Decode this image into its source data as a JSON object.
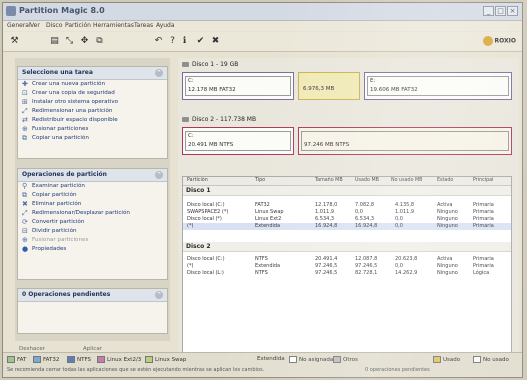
{
  "window": {
    "title": "Partition Magic 8.0"
  },
  "menu": [
    "General",
    "Ver",
    "Disco",
    "Partición",
    "Herramientas",
    "Tareas",
    "Ayuda"
  ],
  "brand": "ROXIO",
  "icons": {
    "undo": "undo-icon",
    "redo": "redo-icon",
    "help": "help-icon"
  },
  "tasks_panel": {
    "title": "Seleccione una tarea",
    "items": [
      "Crear una nueva partición",
      "Crear una copia de seguridad",
      "Instalar otro sistema operativo",
      "Redimensionar una partición",
      "Redistribuir espacio disponible",
      "Fusionar particiones",
      "Copiar una partición"
    ]
  },
  "ops_panel": {
    "title": "Operaciones de partición",
    "items": [
      "Examinar partición",
      "Copiar partición",
      "Eliminar partición",
      "Redimensionar/Desplazar partición",
      "Convertir partición",
      "Dividir partición",
      "Fusionar particiones",
      "Propiedades"
    ]
  },
  "pending_panel": {
    "title": "0 Operaciones pendientes"
  },
  "left_buttons": {
    "undo": "Deshacer",
    "apply": "Aplicar"
  },
  "disk1": {
    "label": "Disco 1 - 19 GB",
    "partitions": [
      {
        "label": "C:",
        "detail": "12.178 MB   FAT32"
      },
      {
        "label": "",
        "detail": "6.976,3 MB"
      },
      {
        "label": "E:",
        "detail": "19.606 MB   FAT32"
      }
    ]
  },
  "disk2": {
    "label": "Disco 2 - 117.738 MB",
    "partitions": [
      {
        "label": "C:",
        "detail": "20.491 MB   NTFS"
      },
      {
        "label": "",
        "detail": "97.246 MB   NTFS"
      }
    ]
  },
  "table": {
    "headers": [
      "Partición",
      "Tipo",
      "Tamaño MB",
      "Usado MB",
      "No usado MB",
      "Estado",
      "Principal"
    ],
    "groups": [
      {
        "title": "Disco 1",
        "rows": [
          [
            "Disco local (C:)",
            "FAT32",
            "12.178,0",
            "7.082,8",
            "4.135,8",
            "Activa",
            "Primaria"
          ],
          [
            "SWAPSPACE2 (*)",
            "Linux Swap",
            "1.011,9",
            "0,0",
            "1.011,9",
            "Ninguno",
            "Primaria"
          ],
          [
            "Disco local (*)",
            "Linux Ext2",
            "6.534,3",
            "6.534,3",
            "0,0",
            "Ninguno",
            "Primaria"
          ],
          [
            "(*)",
            "Extendida",
            "16.924,8",
            "16.924,8",
            "0,0",
            "Ninguno",
            "Primaria"
          ]
        ]
      },
      {
        "title": "Disco 2",
        "rows": [
          [
            "Disco local (C:)",
            "NTFS",
            "20.491,4",
            "12.087,8",
            "20.623,8",
            "Activa",
            "Primaria"
          ],
          [
            "(*)",
            "Extendida",
            "97.246,5",
            "97.246,5",
            "0,0",
            "Ninguno",
            "Primaria"
          ],
          [
            "Disco local (L:)",
            "NTFS",
            "97.246,5",
            "82.728,1",
            "14.262,9",
            "Ninguno",
            "Lógica"
          ]
        ]
      }
    ]
  },
  "legend": [
    "FAT",
    "FAT32",
    "NTFS",
    "Linux Ext2/3",
    "Linux Swap"
  ],
  "legend_colors": [
    "#9bc58f",
    "#7da8d6",
    "#5d7eb7",
    "#c67caa",
    "#b8cf7c"
  ],
  "status_right": [
    "Extendida",
    "No asignada",
    "Otros",
    "Usado",
    "No usado"
  ],
  "status_msg": "Se recomienda cerrar todas las aplicaciones que se estén ejecutando mientras se aplican los cambios.",
  "status_msg2": "0 operaciones pendientes"
}
